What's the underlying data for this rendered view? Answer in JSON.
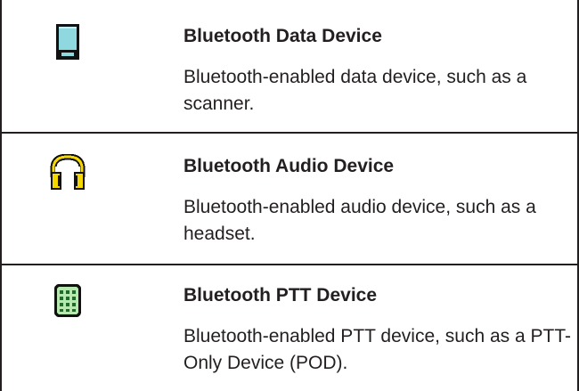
{
  "rows": [
    {
      "icon": "bluetooth-data-device-icon",
      "title": "Bluetooth Data Device",
      "description": "Bluetooth-enabled data device, such as a scanner."
    },
    {
      "icon": "bluetooth-audio-device-icon",
      "title": "Bluetooth Audio Device",
      "description": "Bluetooth-enabled audio device, such as a headset."
    },
    {
      "icon": "bluetooth-ptt-device-icon",
      "title": "Bluetooth PTT Device",
      "description": "Bluetooth-enabled PTT device, such as a PTT-Only Device (POD)."
    }
  ],
  "colors": {
    "border": "#231f20",
    "data_device_screen": "#8fd8e0",
    "headset_yellow": "#f5d800",
    "ptt_green": "#b6e8b0"
  }
}
